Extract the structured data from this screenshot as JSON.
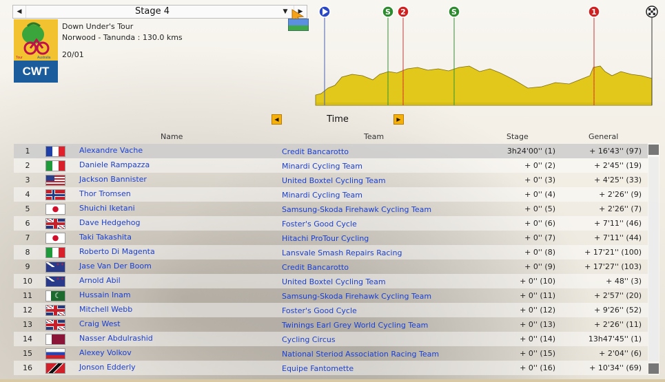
{
  "stage_selector": {
    "label": "Stage 4"
  },
  "race": {
    "name": "Down Under's Tour",
    "route": "Norwood - Tanunda : 130.0 kms",
    "date": "20/01",
    "logo_badge": "CWT",
    "logo_text": "Tour Down Under Australia"
  },
  "profile": {
    "markers": [
      {
        "type": "start",
        "label": "",
        "color": "#2a47c4"
      },
      {
        "type": "sprint",
        "label": "S",
        "color": "#2e8a2e"
      },
      {
        "type": "climb",
        "label": "2",
        "color": "#d02020"
      },
      {
        "type": "sprint",
        "label": "S",
        "color": "#2e8a2e"
      },
      {
        "type": "climb",
        "label": "1",
        "color": "#d02020"
      },
      {
        "type": "finish",
        "label": "",
        "color": "#222222"
      }
    ]
  },
  "view": {
    "label": "Time"
  },
  "columns": {
    "name": "Name",
    "team": "Team",
    "stage": "Stage",
    "general": "General"
  },
  "riders": [
    {
      "pos": "1",
      "flag": "fr",
      "name": "Alexandre Vache",
      "team": "Credit Bancarotto",
      "stage": "3h24'00'' (1)",
      "general": "+ 16'43'' (97)"
    },
    {
      "pos": "2",
      "flag": "it",
      "name": "Daniele Rampazza",
      "team": "Minardi Cycling Team",
      "stage": "+ 0'' (2)",
      "general": "+ 2'45'' (19)"
    },
    {
      "pos": "3",
      "flag": "us",
      "name": "Jackson Bannister",
      "team": "United Boxtel Cycling Team",
      "stage": "+ 0'' (3)",
      "general": "+ 4'25'' (33)"
    },
    {
      "pos": "4",
      "flag": "no",
      "name": "Thor Tromsen",
      "team": "Minardi Cycling Team",
      "stage": "+ 0'' (4)",
      "general": "+ 2'26'' (9)"
    },
    {
      "pos": "5",
      "flag": "jp",
      "name": "Shuichi Iketani",
      "team": "Samsung-Skoda Firehawk Cycling Team",
      "stage": "+ 0'' (5)",
      "general": "+ 2'26'' (7)"
    },
    {
      "pos": "6",
      "flag": "gb",
      "name": "Dave Hedgehog",
      "team": "Foster's Good Cycle",
      "stage": "+ 0'' (6)",
      "general": "+ 7'11'' (46)"
    },
    {
      "pos": "7",
      "flag": "jp",
      "name": "Taki Takashita",
      "team": "Hitachi ProTour Cycling",
      "stage": "+ 0'' (7)",
      "general": "+ 7'11'' (44)"
    },
    {
      "pos": "8",
      "flag": "it",
      "name": "Roberto Di Magenta",
      "team": "Lansvale Smash Repairs Racing",
      "stage": "+ 0'' (8)",
      "general": "+ 17'21'' (100)"
    },
    {
      "pos": "9",
      "flag": "nz",
      "name": "Jase Van Der Boom",
      "team": "Credit Bancarotto",
      "stage": "+ 0'' (9)",
      "general": "+ 17'27'' (103)"
    },
    {
      "pos": "10",
      "flag": "nz",
      "name": "Arnold Abil",
      "team": "United Boxtel Cycling Team",
      "stage": "+ 0'' (10)",
      "general": "+ 48'' (3)"
    },
    {
      "pos": "11",
      "flag": "pk",
      "name": "Hussain Inam",
      "team": "Samsung-Skoda Firehawk Cycling Team",
      "stage": "+ 0'' (11)",
      "general": "+ 2'57'' (20)"
    },
    {
      "pos": "12",
      "flag": "gb",
      "name": "Mitchell Webb",
      "team": "Foster's Good Cycle",
      "stage": "+ 0'' (12)",
      "general": "+ 9'26'' (52)"
    },
    {
      "pos": "13",
      "flag": "gb",
      "name": "Craig West",
      "team": "Twinings Earl Grey World Cycling Team",
      "stage": "+ 0'' (13)",
      "general": "+ 2'26'' (11)"
    },
    {
      "pos": "14",
      "flag": "qa",
      "name": "Nasser Abdulrashid",
      "team": "Cycling Circus",
      "stage": "+ 0'' (14)",
      "general": "13h47'45'' (1)"
    },
    {
      "pos": "15",
      "flag": "ru",
      "name": "Alexey Volkov",
      "team": "National Steriod Association Racing Team",
      "stage": "+ 0'' (15)",
      "general": "+ 2'04'' (6)"
    },
    {
      "pos": "16",
      "flag": "tt",
      "name": "Jonson Edderly",
      "team": "Equipe Fantomette",
      "stage": "+ 0'' (16)",
      "general": "+ 10'34'' (69)"
    }
  ]
}
